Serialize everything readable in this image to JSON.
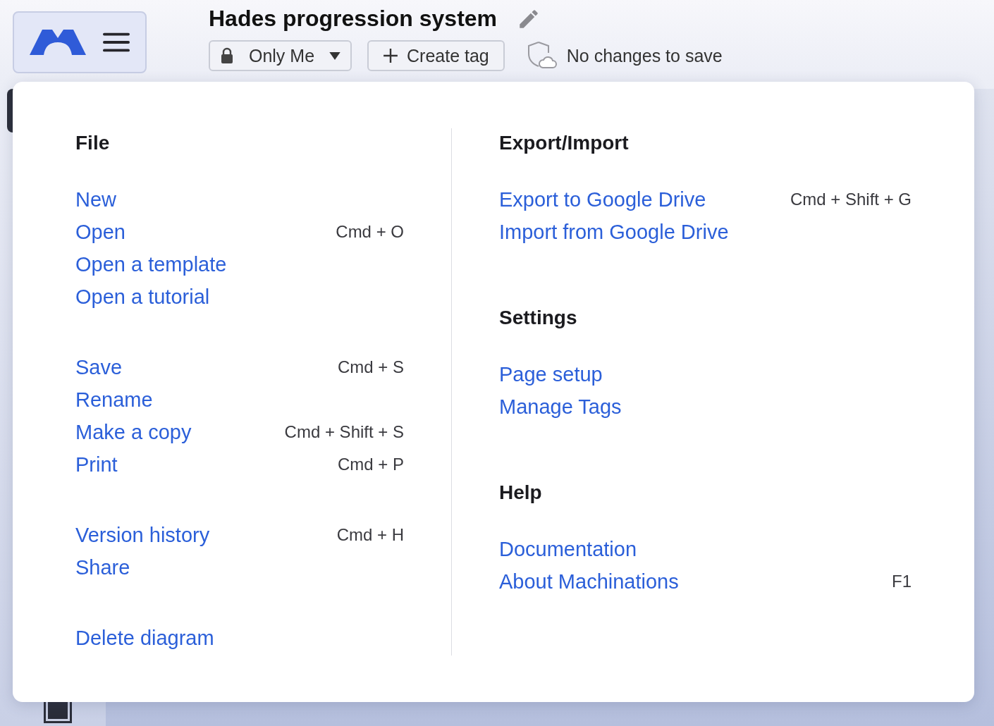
{
  "header": {
    "title": "Hades progression system",
    "visibility": {
      "label": "Only Me"
    },
    "create_tag": {
      "label": "Create tag"
    },
    "save_status": "No changes to save"
  },
  "menu": {
    "columns": [
      {
        "sections": [
          {
            "title": "File",
            "items": [
              {
                "label": "New"
              },
              {
                "label": "Open",
                "shortcut": "Cmd + O"
              },
              {
                "label": "Open a template"
              },
              {
                "label": "Open a tutorial"
              }
            ]
          },
          {
            "items": [
              {
                "label": "Save",
                "shortcut": "Cmd + S"
              },
              {
                "label": "Rename"
              },
              {
                "label": "Make a copy",
                "shortcut": "Cmd + Shift + S"
              },
              {
                "label": "Print",
                "shortcut": "Cmd + P"
              }
            ]
          },
          {
            "items": [
              {
                "label": "Version history",
                "shortcut": "Cmd + H"
              },
              {
                "label": "Share"
              }
            ]
          },
          {
            "items": [
              {
                "label": "Delete diagram"
              }
            ]
          }
        ]
      },
      {
        "sections": [
          {
            "title": "Export/Import",
            "items": [
              {
                "label": "Export to Google Drive",
                "shortcut": "Cmd + Shift + G"
              },
              {
                "label": "Import from Google Drive"
              }
            ]
          },
          {
            "title": "Settings",
            "items": [
              {
                "label": "Page setup"
              },
              {
                "label": "Manage Tags"
              }
            ]
          },
          {
            "title": "Help",
            "items": [
              {
                "label": "Documentation"
              },
              {
                "label": "About Machinations",
                "shortcut": "F1"
              }
            ]
          }
        ]
      }
    ]
  }
}
